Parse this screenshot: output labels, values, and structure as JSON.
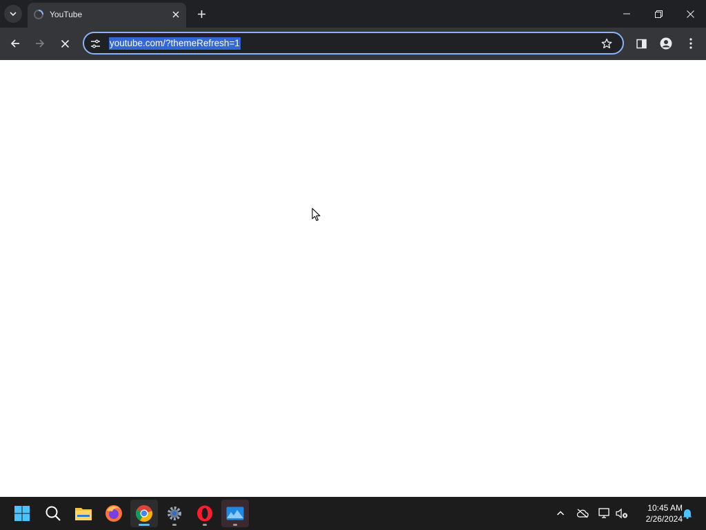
{
  "browser": {
    "tab": {
      "title": "YouTube"
    },
    "address_bar": {
      "url": "youtube.com/?themeRefresh=1"
    },
    "colors": {
      "accent": "#8ab4f8",
      "selection": "#3367d6",
      "frame": "#202124",
      "toolbar": "#35363a"
    }
  },
  "taskbar": {
    "apps": [
      {
        "name": "start",
        "icon": "windows-logo-icon"
      },
      {
        "name": "search",
        "icon": "search-icon"
      },
      {
        "name": "file-explorer",
        "icon": "folder-icon"
      },
      {
        "name": "firefox",
        "icon": "firefox-icon"
      },
      {
        "name": "chrome",
        "icon": "chrome-icon",
        "active": true
      },
      {
        "name": "settings",
        "icon": "gear-icon"
      },
      {
        "name": "opera",
        "icon": "opera-icon"
      },
      {
        "name": "photos",
        "icon": "photos-icon"
      }
    ],
    "clock": {
      "time": "10:45 AM",
      "date": "2/26/2024"
    }
  }
}
